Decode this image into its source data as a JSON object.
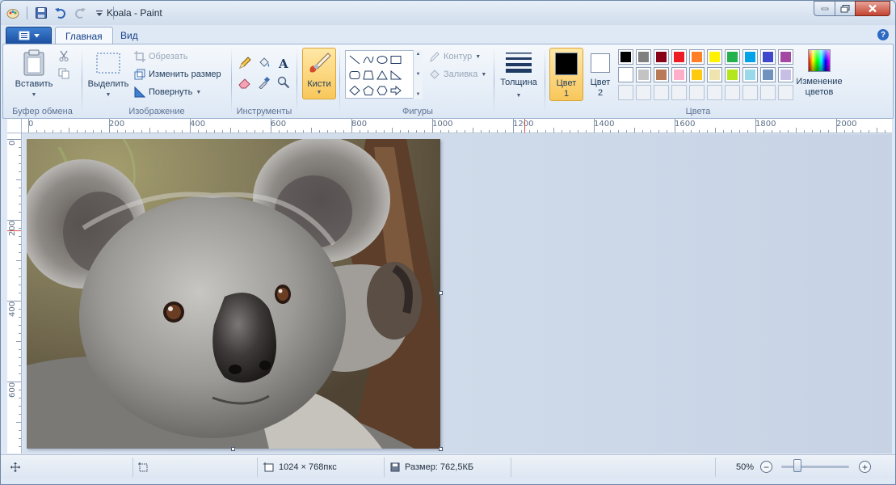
{
  "window": {
    "title": "Koala - Paint"
  },
  "tabs": [
    {
      "label": "Главная",
      "active": true
    },
    {
      "label": "Вид",
      "active": false
    }
  ],
  "ribbon": {
    "clipboard": {
      "paste_label": "Вставить",
      "group_label": "Буфер обмена"
    },
    "image": {
      "select_label": "Выделить",
      "crop_label": "Обрезать",
      "resize_label": "Изменить размер",
      "rotate_label": "Повернуть",
      "group_label": "Изображение"
    },
    "tools": {
      "group_label": "Инструменты",
      "items": [
        "pencil-icon",
        "fill-icon",
        "text-icon",
        "eraser-icon",
        "color-picker-icon",
        "magnifier-icon"
      ]
    },
    "brushes": {
      "label": "Кисти"
    },
    "shapes": {
      "outline_label": "Контур",
      "fill_label": "Заливка",
      "group_label": "Фигуры"
    },
    "size": {
      "label": "Толщина"
    },
    "colors": {
      "color1_label_line1": "Цвет",
      "color1_label_line2": "1",
      "color2_label_line1": "Цвет",
      "color2_label_line2": "2",
      "color1_value": "#000000",
      "color2_value": "#ffffff",
      "edit_colors_line1": "Изменение",
      "edit_colors_line2": "цветов",
      "group_label": "Цвета",
      "palette": [
        "#000000",
        "#7f7f7f",
        "#880015",
        "#ed1c24",
        "#ff7f27",
        "#fff200",
        "#22b14c",
        "#00a2e8",
        "#3f48cc",
        "#a349a4",
        "#ffffff",
        "#c3c3c3",
        "#b97a57",
        "#ffaec9",
        "#ffc90e",
        "#efe4b0",
        "#b5e61d",
        "#99d9ea",
        "#7092be",
        "#c8bfe7"
      ]
    }
  },
  "ruler": {
    "top_labels": [
      "0",
      "200",
      "400",
      "600",
      "800",
      "1000",
      "1200",
      "1400",
      "1600",
      "1800",
      "2000"
    ],
    "left_labels": [
      "0",
      "200",
      "400",
      "600"
    ]
  },
  "status": {
    "dimensions": "1024 × 768пкс",
    "size": "Размер: 762,5КБ",
    "zoom": "50%"
  }
}
